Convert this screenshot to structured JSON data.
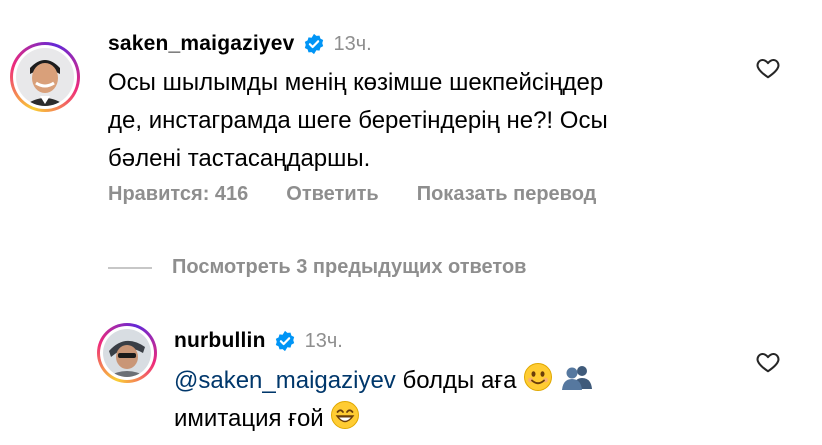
{
  "comment": {
    "username": "saken_maigaziyev",
    "time": "13ч.",
    "text_line1": "Осы шылымды менің көзімше шекпейсіңдер",
    "text_line2": "де, инстаграмда шеге беретіндерің не?! Осы",
    "text_line3": "бәлені тастасаңдаршы.",
    "likes_label": "Нравится: 416",
    "reply_label": "Ответить",
    "translate_label": "Показать перевод",
    "avatar_icon": "person-portrait-icon",
    "verified_icon": "verified-badge-icon"
  },
  "view_previous_replies": "Посмотреть 3 предыдущих ответов",
  "reply": {
    "username": "nurbullin",
    "time": "13ч.",
    "mention": "@saken_maigaziyev",
    "text_part1": " болды аға ",
    "text_line2": "имитация ғой ",
    "avatar_icon": "person-portrait-icon",
    "verified_icon": "verified-badge-icon"
  },
  "colors": {
    "username": "#000000",
    "secondary": "#8e8e8e",
    "mention": "#00376b",
    "verified": "#0095f6"
  }
}
